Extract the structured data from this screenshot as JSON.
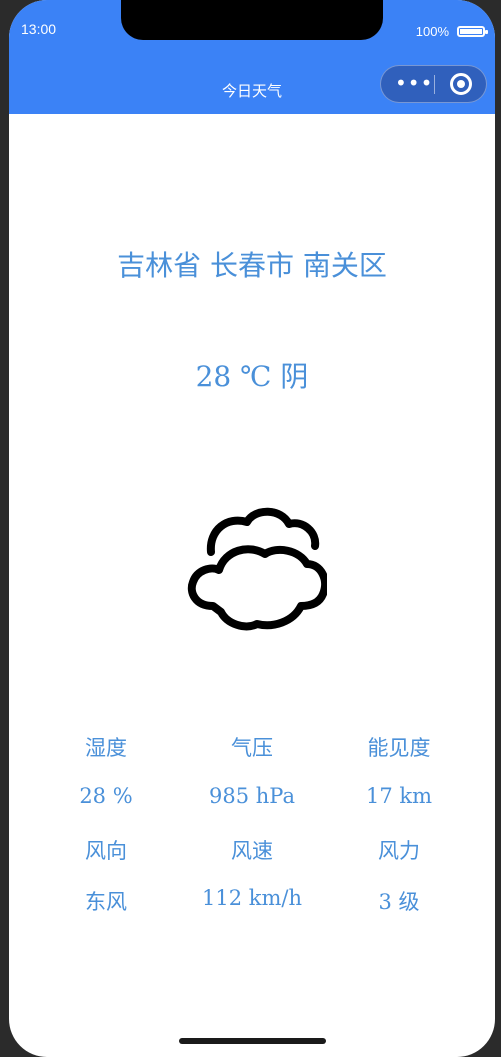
{
  "status_bar": {
    "time": "13:00",
    "battery": "100%"
  },
  "nav": {
    "title": "今日天气",
    "capsule_menu_icon": "more-dots-icon",
    "capsule_close_icon": "target-icon"
  },
  "weather": {
    "location": "吉林省 长春市 南关区",
    "temperature_line": "28 ℃ 阴",
    "icon": "cloudy-icon"
  },
  "details": {
    "humidity_label": "湿度",
    "pressure_label": "气压",
    "visibility_label": "能见度",
    "humidity_value": "28 %",
    "pressure_value": "985 hPa",
    "visibility_value": "17 km",
    "wind_dir_label": "风向",
    "wind_speed_label": "风速",
    "wind_force_label": "风力",
    "wind_dir_value": "东风",
    "wind_speed_value": "112 km/h",
    "wind_force_value": "3 级"
  },
  "colors": {
    "header": "#3b82f6",
    "accent_text": "#4a90d9"
  }
}
